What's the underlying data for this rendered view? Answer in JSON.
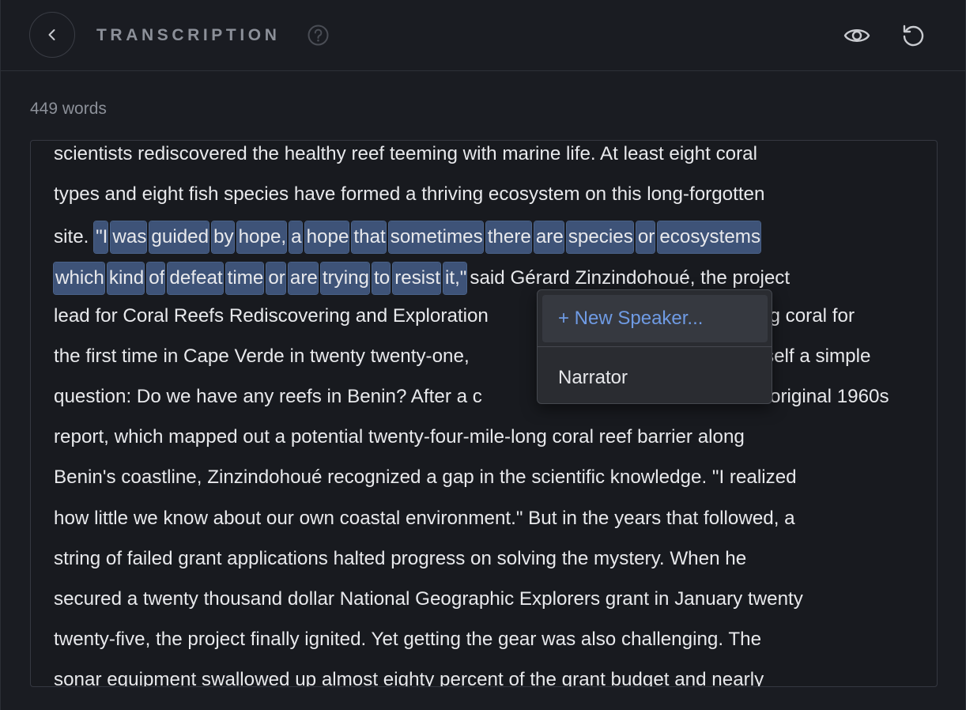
{
  "header": {
    "title": "TRANSCRIPTION"
  },
  "word_count": "449 words",
  "transcript": {
    "line1": "scientists rediscovered the healthy reef teeming with marine life. At least eight coral",
    "line2": "types and eight fish species have formed a thriving ecosystem on this long-forgotten",
    "line3_pre": "site. ",
    "line3_sel": [
      "\"I",
      "was",
      "guided",
      "by",
      "hope,",
      "a",
      "hope",
      "that",
      "sometimes",
      "there",
      "are",
      "species",
      "or",
      "ecosystems"
    ],
    "line4_sel": [
      "which",
      "kind",
      "of",
      "defeat",
      "time",
      "or",
      "are",
      "trying",
      "to",
      "resist",
      "it,\""
    ],
    "line4_post": "said Gérard Zinzindohoué, the project",
    "line5_a": "lead for Coral Reefs Rediscovering and Exploration",
    "line5_b": "ng coral for",
    "line6_a": "the first time in Cape Verde in twenty twenty-one,",
    "line6_b": "self a simple",
    "line7_a": "question: Do we have any reefs in Benin? After a c",
    "line7_b": "original 1960s",
    "line8": "report, which mapped out a potential twenty-four-mile-long coral reef barrier along",
    "line9": "Benin's coastline, Zinzindohoué recognized a gap in the scientific knowledge. \"I realized",
    "line10": "how little we know about our own coastal environment.\" But in the years that followed, a",
    "line11": "string of failed grant applications halted progress on solving the mystery. When he",
    "line12": "secured a twenty thousand dollar National Geographic Explorers grant in January twenty",
    "line13": "twenty-five, the project finally ignited. Yet getting the gear was also challenging. The",
    "line14": "sonar equipment swallowed up almost eighty percent of the grant budget and nearly"
  },
  "speaker_menu": {
    "new_speaker": "+ New Speaker...",
    "options": [
      "Narrator"
    ]
  },
  "colors": {
    "background": "#1a1c22",
    "selection": "#3e5378",
    "accent": "#6f9be4"
  },
  "icons": [
    "chevron-left-icon",
    "help-icon",
    "eye-icon",
    "reset-icon"
  ]
}
